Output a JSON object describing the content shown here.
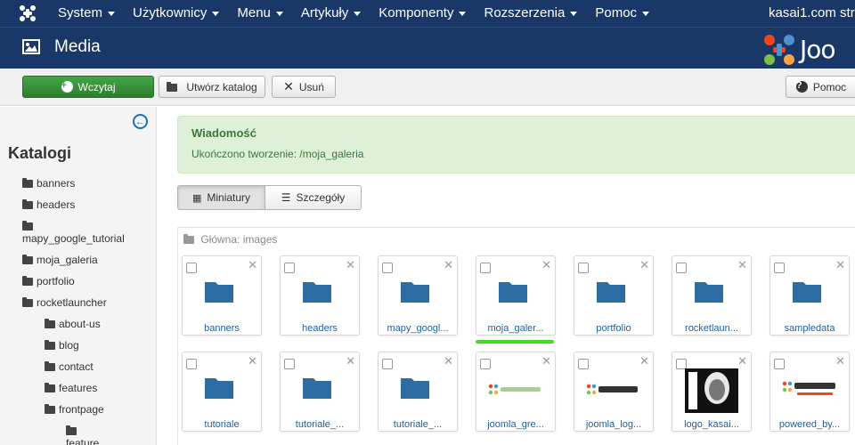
{
  "navbar": {
    "menu": [
      "System",
      "Użytkownicy",
      "Menu",
      "Artykuły",
      "Komponenty",
      "Rozszerzenia",
      "Pomoc"
    ],
    "site_label": "kasai1.com str."
  },
  "header": {
    "title": "Media",
    "brand_text": "Joo"
  },
  "toolbar": {
    "upload_label": "Wczytaj",
    "create_folder_label": "Utwórz katalog",
    "delete_label": "Usuń",
    "help_label": "Pomoc"
  },
  "sidebar": {
    "title": "Katalogi",
    "collapse_icon": "arrow-left-circle-icon",
    "items": [
      "banners",
      "headers",
      "mapy_google_tutorial",
      "moja_galeria",
      "portfolio",
      "rocketlauncher",
      "about-us",
      "blog",
      "contact",
      "features",
      "frontpage",
      "feature"
    ]
  },
  "alert": {
    "heading": "Wiadomość",
    "message": "Ukończono tworzenie: /moja_galeria"
  },
  "views": {
    "thumbnails": "Miniatury",
    "details": "Szczegóły"
  },
  "breadcrumb": "Główna: images",
  "items_row1": [
    "banners",
    "headers",
    "mapy_googl...",
    "moja_galer...",
    "portfolio",
    "rocketlaun...",
    "sampledata"
  ],
  "items_row2": [
    "tutoriale",
    "tutoriale_...",
    "tutoriale_...",
    "joomla_gre...",
    "joomla_log...",
    "logo_kasai...",
    "powered_by..."
  ],
  "colors": {
    "navbar": "#1a3867",
    "success": "#46a546",
    "alert_bg": "#dff0d8",
    "link": "#1f5e9e",
    "folder": "#2e6da4",
    "selection": "#44dd22"
  }
}
